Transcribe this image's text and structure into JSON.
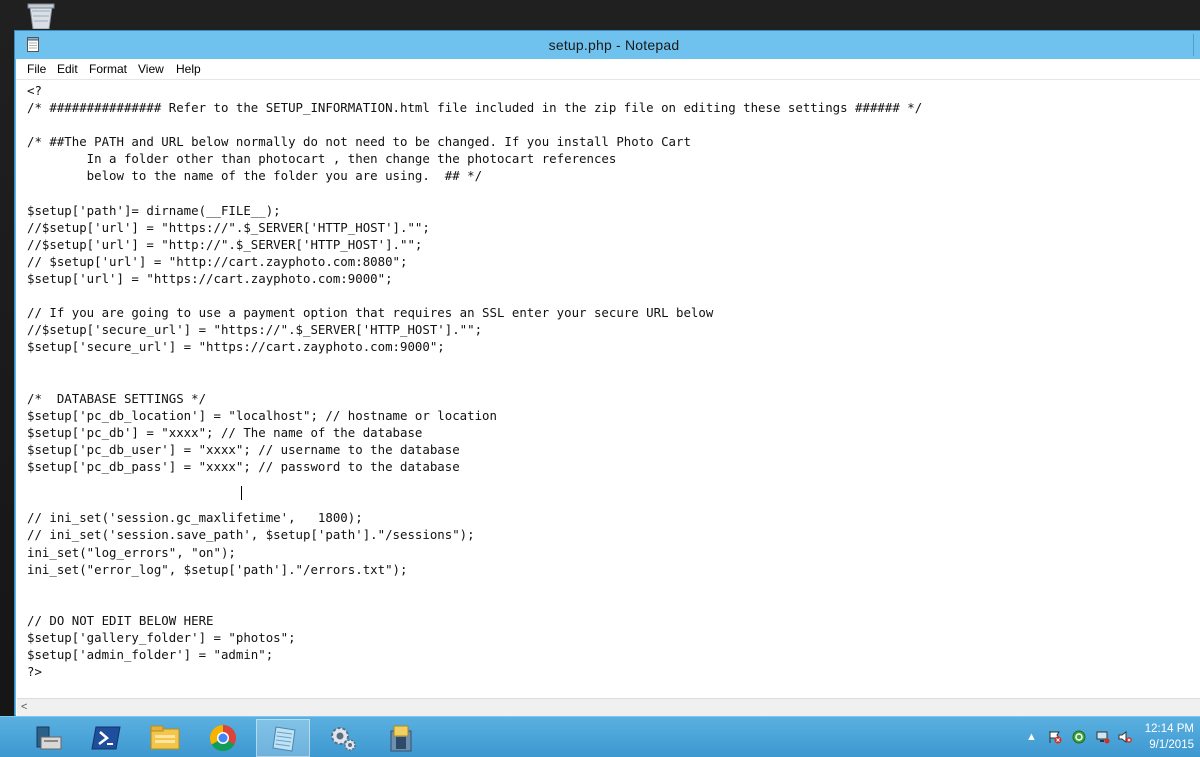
{
  "window": {
    "title": "setup.php - Notepad"
  },
  "menu": [
    "File",
    "Edit",
    "Format",
    "View",
    "Help"
  ],
  "editor": {
    "lines": [
      "<?",
      "/* ############### Refer to the SETUP_INFORMATION.html file included in the zip file on editing these settings ###### */",
      "",
      "/* ##The PATH and URL below normally do not need to be changed. If you install Photo Cart",
      "        In a folder other than photocart , then change the photocart references",
      "        below to the name of the folder you are using.  ## */",
      "",
      "$setup['path']= dirname(__FILE__);",
      "//$setup['url'] = \"https://\".$_SERVER['HTTP_HOST'].\"\";",
      "//$setup['url'] = \"http://\".$_SERVER['HTTP_HOST'].\"\";",
      "// $setup['url'] = \"http://cart.zayphoto.com:8080\";",
      "$setup['url'] = \"https://cart.zayphoto.com:9000\";",
      "",
      "// If you are going to use a payment option that requires an SSL enter your secure URL below",
      "//$setup['secure_url'] = \"https://\".$_SERVER['HTTP_HOST'].\"\";",
      "$setup['secure_url'] = \"https://cart.zayphoto.com:9000\";",
      "",
      "",
      "/*  DATABASE SETTINGS */",
      "$setup['pc_db_location'] = \"localhost\"; // hostname or location",
      "$setup['pc_db'] = \"xxxx\"; // The name of the database",
      "$setup['pc_db_user'] = \"xxxx\"; // username to the database",
      "$setup['pc_db_pass'] = \"xxxx\"; // password to the database",
      "",
      "",
      "// ini_set('session.gc_maxlifetime',   1800);",
      "// ini_set('session.save_path', $setup['path'].\"/sessions\");",
      "ini_set(\"log_errors\", \"on\");",
      "ini_set(\"error_log\", $setup['path'].\"/errors.txt\");",
      "",
      "",
      "// DO NOT EDIT BELOW HERE",
      "$setup['gallery_folder'] = \"photos\";",
      "$setup['admin_folder'] = \"admin\";",
      "?>"
    ]
  },
  "scrollbar": {
    "left_arrow": "<"
  },
  "taskbar": {
    "items": [
      {
        "name": "server-manager-icon"
      },
      {
        "name": "powershell-icon"
      },
      {
        "name": "file-explorer-icon"
      },
      {
        "name": "chrome-icon"
      },
      {
        "name": "notepad-icon",
        "active": true
      },
      {
        "name": "settings-gear-icon"
      },
      {
        "name": "installer-icon"
      }
    ],
    "tray_up": "▲",
    "time": "12:14 PM",
    "date": "9/1/2015"
  },
  "colors": {
    "titlebar": "#6fc2ee",
    "taskbar": "#4aa4d8"
  }
}
